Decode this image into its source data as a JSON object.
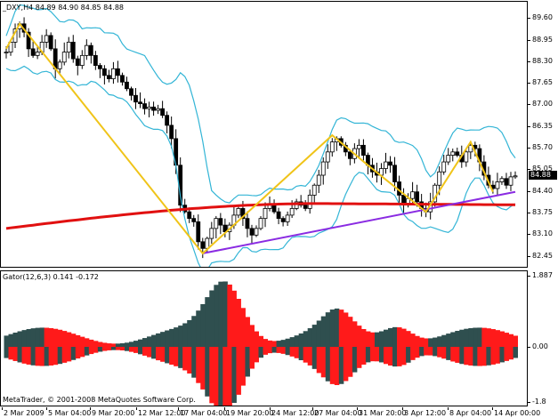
{
  "chart_header": {
    "symbol": "_DXY,H4",
    "open": "84.89",
    "high": "84.90",
    "low": "84.85",
    "close": "84.88"
  },
  "indicator_header": "Gator(12,6,3) 0.141 -0.172",
  "copyright": "MetaTrader, © 2001-2008 MetaQuotes Software Corp.",
  "current_price": "84.88",
  "colors": {
    "bollinger": "#33b5d6",
    "zigzag": "#f0c419",
    "ma_long": "#e11010",
    "trendline": "#8a2be2",
    "gator_up": "#ff1a1a",
    "gator_down": "#2f4f4f",
    "candle": "#000000"
  },
  "chart_data": {
    "type": "candlestick",
    "symbol": "_DXY",
    "timeframe": "H4",
    "ylim": [
      82.2,
      89.9
    ],
    "y_ticks": [
      "89.60",
      "88.95",
      "88.30",
      "87.65",
      "87.00",
      "86.35",
      "85.70",
      "85.05",
      "84.40",
      "83.75",
      "83.10",
      "82.45"
    ],
    "x_ticks": [
      "2 Mar 2009",
      "5 Mar 04:00",
      "9 Mar 20:00",
      "12 Mar 12:00",
      "17 Mar 04:00",
      "19 Mar 20:00",
      "24 Mar 12:00",
      "27 Mar 04:00",
      "31 Mar 20:00",
      "3 Apr 12:00",
      "8 Apr 04:00",
      "14 Apr 00:00"
    ],
    "close_series": [
      88.6,
      88.9,
      89.3,
      89.45,
      89.2,
      88.7,
      88.5,
      88.6,
      88.9,
      89.1,
      88.7,
      88.1,
      88.3,
      88.6,
      88.9,
      88.4,
      88.2,
      88.5,
      88.8,
      88.5,
      88.2,
      88.1,
      87.9,
      87.8,
      88.1,
      87.9,
      87.7,
      87.5,
      87.3,
      87.1,
      87.05,
      86.9,
      86.95,
      86.85,
      86.9,
      86.7,
      86.4,
      86.0,
      85.2,
      84.0,
      83.8,
      83.6,
      83.5,
      82.9,
      82.7,
      83.0,
      83.3,
      83.6,
      83.4,
      83.2,
      83.4,
      83.7,
      83.9,
      83.6,
      83.3,
      83.1,
      83.3,
      83.6,
      83.9,
      84.0,
      83.8,
      83.6,
      83.5,
      83.7,
      83.9,
      84.1,
      84.0,
      83.9,
      84.3,
      84.6,
      84.9,
      85.3,
      85.6,
      85.9,
      86.0,
      85.8,
      85.6,
      85.4,
      85.7,
      85.8,
      85.5,
      85.2,
      85.0,
      84.9,
      85.1,
      85.3,
      85.2,
      84.7,
      84.3,
      84.0,
      84.2,
      84.4,
      84.1,
      83.9,
      83.8,
      84.1,
      84.6,
      85.0,
      85.3,
      85.5,
      85.6,
      85.5,
      85.3,
      85.6,
      85.8,
      85.7,
      85.3,
      84.9,
      84.6,
      84.5,
      84.7,
      84.8,
      84.6,
      84.85,
      84.88
    ],
    "zigzag_points": [
      {
        "x": "2 Mar 2009",
        "y": 88.7
      },
      {
        "x": "4 Mar",
        "y": 89.45
      },
      {
        "x": "19 Mar 00:00",
        "y": 82.55
      },
      {
        "x": "28 Mar",
        "y": 86.1
      },
      {
        "x": "2 Apr",
        "y": 85.2
      },
      {
        "x": "3 Apr 12:00",
        "y": 83.8
      },
      {
        "x": "11 Apr",
        "y": 85.9
      },
      {
        "x": "13 Apr",
        "y": 84.4
      }
    ],
    "gator": {
      "name": "Gator(12,6,3)",
      "upper_value": 0.141,
      "lower_value": -0.172,
      "y_ticks": [
        "1.887",
        "0.00",
        "-1.8"
      ]
    }
  }
}
